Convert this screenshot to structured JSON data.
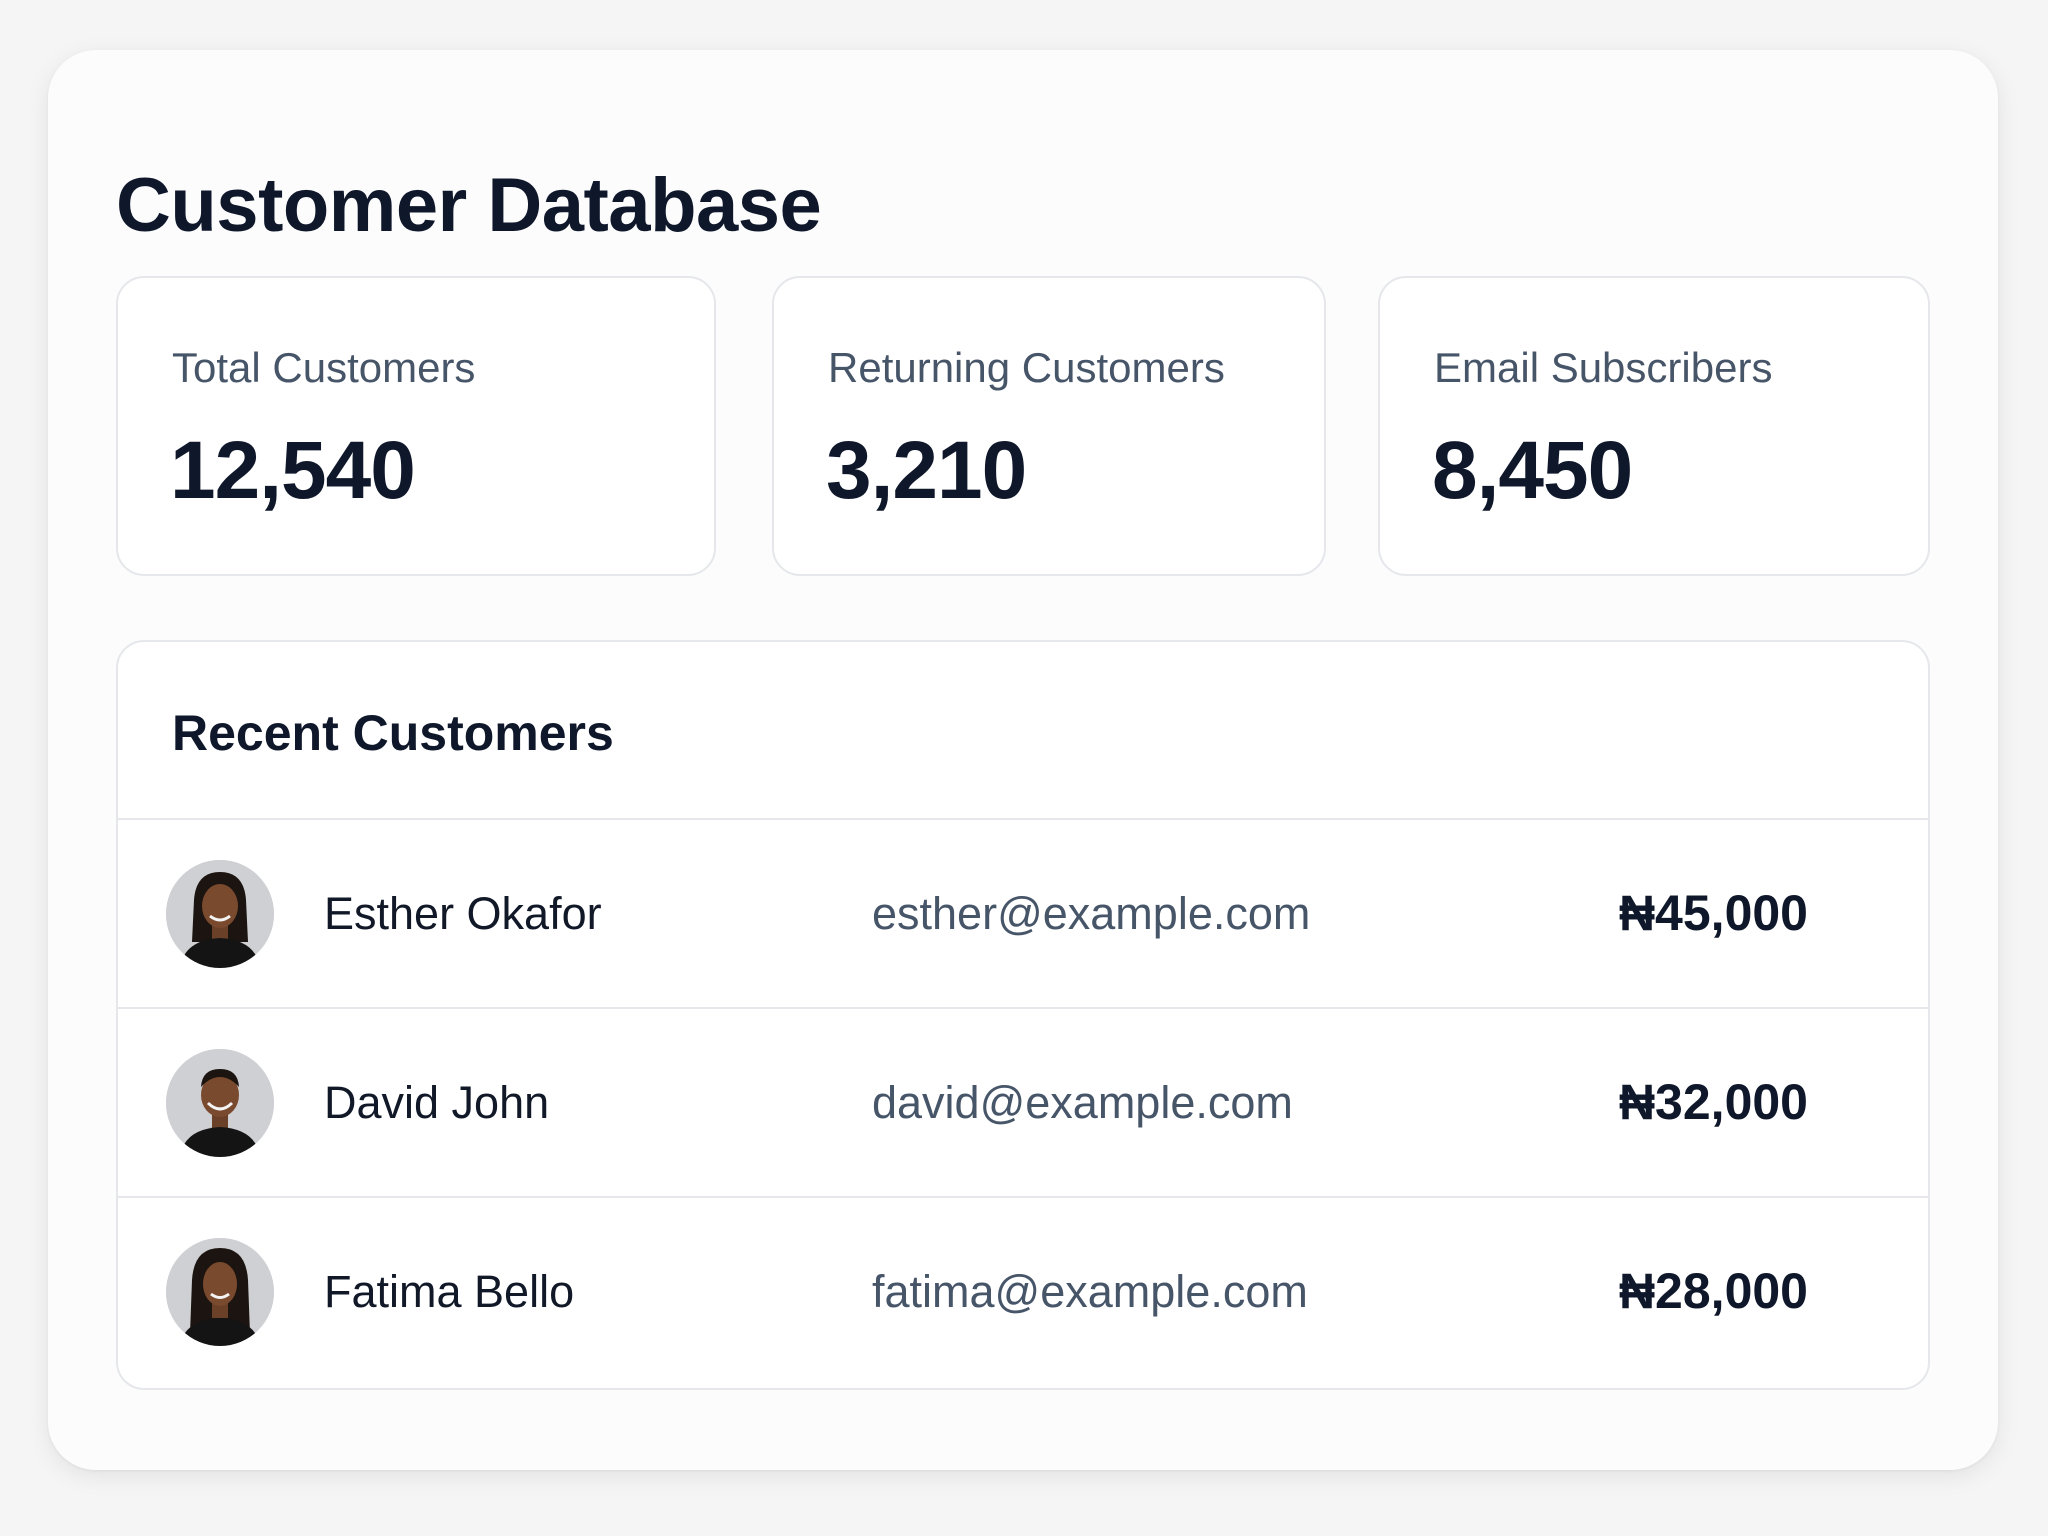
{
  "page": {
    "title": "Customer Database"
  },
  "stats": [
    {
      "label": "Total Customers",
      "value": "12,540"
    },
    {
      "label": "Returning Customers",
      "value": "3,210"
    },
    {
      "label": "Email Subscribers",
      "value": "8,450"
    }
  ],
  "recent": {
    "title": "Recent Customers",
    "customers": [
      {
        "name": "Esther Okafor",
        "email": "esther@example.com",
        "amount": "₦45,000"
      },
      {
        "name": "David John",
        "email": "david@example.com",
        "amount": "₦32,000"
      },
      {
        "name": "Fatima Bello",
        "email": "fatima@example.com",
        "amount": "₦28,000"
      }
    ]
  },
  "colors": {
    "background": "#f5f5f6",
    "card": "#fcfcfd",
    "border": "#e5e7eb",
    "text_primary": "#0f172a",
    "text_secondary": "#475569"
  }
}
